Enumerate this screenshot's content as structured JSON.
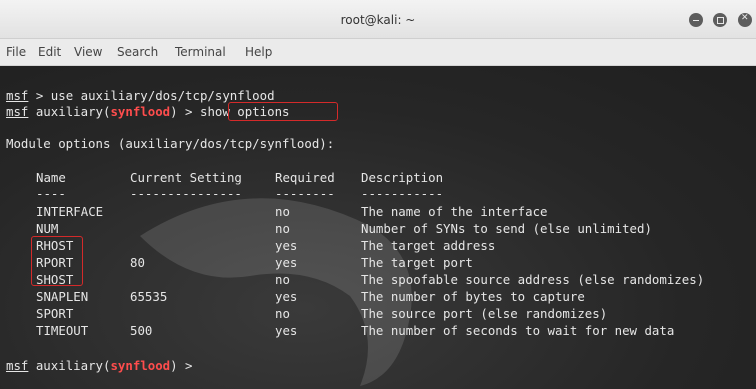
{
  "window": {
    "title": "root@kali: ~"
  },
  "menu": [
    "File",
    "Edit",
    "View",
    "Search",
    "Terminal",
    "Help"
  ],
  "terminal": {
    "line1": {
      "prompt": "msf",
      "text": " > use auxiliary/dos/tcp/synflood"
    },
    "line2": {
      "prompt": "msf",
      "prefix": " auxiliary(",
      "module": "synflood",
      "suffix": ") > ",
      "command": "show options"
    },
    "module_options_header": "Module options (auxiliary/dos/tcp/synflood):",
    "table": {
      "headers": [
        "Name",
        "Current Setting",
        "Required",
        "Description"
      ],
      "underlines": [
        "----",
        "---------------",
        "--------",
        "-----------"
      ],
      "rows": [
        {
          "name": "INTERFACE",
          "setting": "",
          "required": "no",
          "description": "The name of the interface"
        },
        {
          "name": "NUM",
          "setting": "",
          "required": "no",
          "description": "Number of SYNs to send (else unlimited)"
        },
        {
          "name": "RHOST",
          "setting": "",
          "required": "yes",
          "description": "The target address"
        },
        {
          "name": "RPORT",
          "setting": "80",
          "required": "yes",
          "description": "The target port"
        },
        {
          "name": "SHOST",
          "setting": "",
          "required": "no",
          "description": "The spoofable source address (else randomizes)"
        },
        {
          "name": "SNAPLEN",
          "setting": "65535",
          "required": "yes",
          "description": "The number of bytes to capture"
        },
        {
          "name": "SPORT",
          "setting": "",
          "required": "no",
          "description": "The source port (else randomizes)"
        },
        {
          "name": "TIMEOUT",
          "setting": "500",
          "required": "yes",
          "description": "The number of seconds to wait for new data"
        }
      ]
    },
    "last_line": {
      "prompt": "msf",
      "prefix": " auxiliary(",
      "module": "synflood",
      "suffix": ") >"
    }
  }
}
